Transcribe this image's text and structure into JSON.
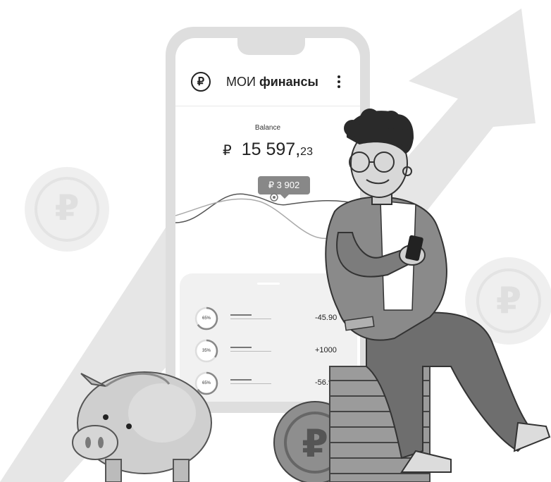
{
  "app": {
    "title_regular": "МОИ",
    "title_bold": "финансы",
    "logo_symbol": "₽"
  },
  "balance": {
    "label": "Balance",
    "currency": "₽",
    "amount_main": "15 597,",
    "amount_cents": "23"
  },
  "chart_tooltip": "₽ 3 902",
  "transactions": [
    {
      "percent": "65%",
      "fraction": 0.65,
      "amount": "-45.90"
    },
    {
      "percent": "35%",
      "fraction": 0.35,
      "amount": "+1000"
    },
    {
      "percent": "65%",
      "fraction": 0.65,
      "amount": "-56.90"
    }
  ],
  "colors": {
    "light_gray": "#dedede",
    "mid_gray": "#a8a8a8",
    "dark_gray": "#6e6e6e",
    "ink": "#222222"
  }
}
